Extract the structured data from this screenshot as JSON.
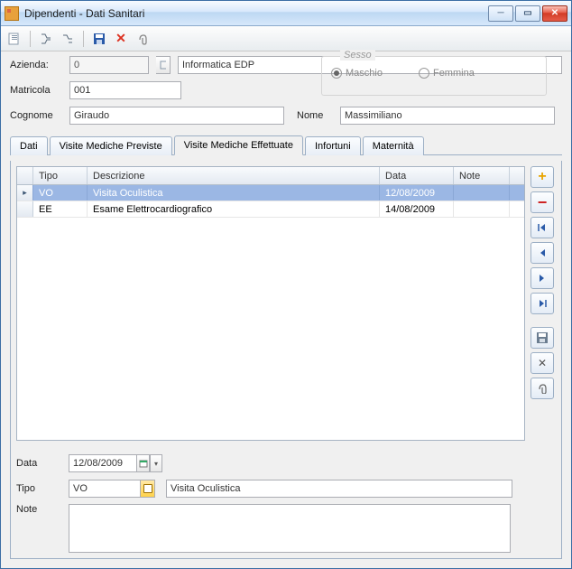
{
  "window": {
    "title": "Dipendenti - Dati Sanitari"
  },
  "toolbar": {
    "new": "new",
    "search": "search",
    "list": "list",
    "save": "save",
    "delete": "delete",
    "attach": "attach"
  },
  "form": {
    "labels": {
      "azienda": "Azienda:",
      "matricola": "Matricola",
      "cognome": "Cognome",
      "nome": "Nome",
      "sesso": "Sesso",
      "maschio": "Maschio",
      "femmina": "Femmina"
    },
    "azienda_code": "0",
    "azienda_desc": "Informatica EDP",
    "matricola": "001",
    "cognome": "Giraudo",
    "nome": "Massimiliano",
    "sesso": "M"
  },
  "tabs": {
    "dati": "Dati",
    "previste": "Visite Mediche Previste",
    "effettuate": "Visite Mediche Effettuate",
    "infortuni": "Infortuni",
    "maternita": "Maternità",
    "active": "effettuate"
  },
  "grid": {
    "headers": {
      "tipo": "Tipo",
      "descrizione": "Descrizione",
      "data": "Data",
      "note": "Note"
    },
    "rows": [
      {
        "tipo": "VO",
        "descrizione": "Visita Oculistica",
        "data": "12/08/2009",
        "note": "",
        "selected": true
      },
      {
        "tipo": "EE",
        "descrizione": "Esame Elettrocardiografico",
        "data": "14/08/2009",
        "note": "",
        "selected": false
      }
    ]
  },
  "details": {
    "labels": {
      "data": "Data",
      "tipo": "Tipo",
      "note": "Note"
    },
    "data": "12/08/2009",
    "tipo_code": "VO",
    "tipo_desc": "Visita Oculistica",
    "note": ""
  },
  "sidebuttons": {
    "add": "+",
    "remove": "−",
    "first": "first",
    "prev": "prev",
    "next": "next",
    "last": "last",
    "save": "save",
    "delete": "delete",
    "attach": "attach"
  }
}
